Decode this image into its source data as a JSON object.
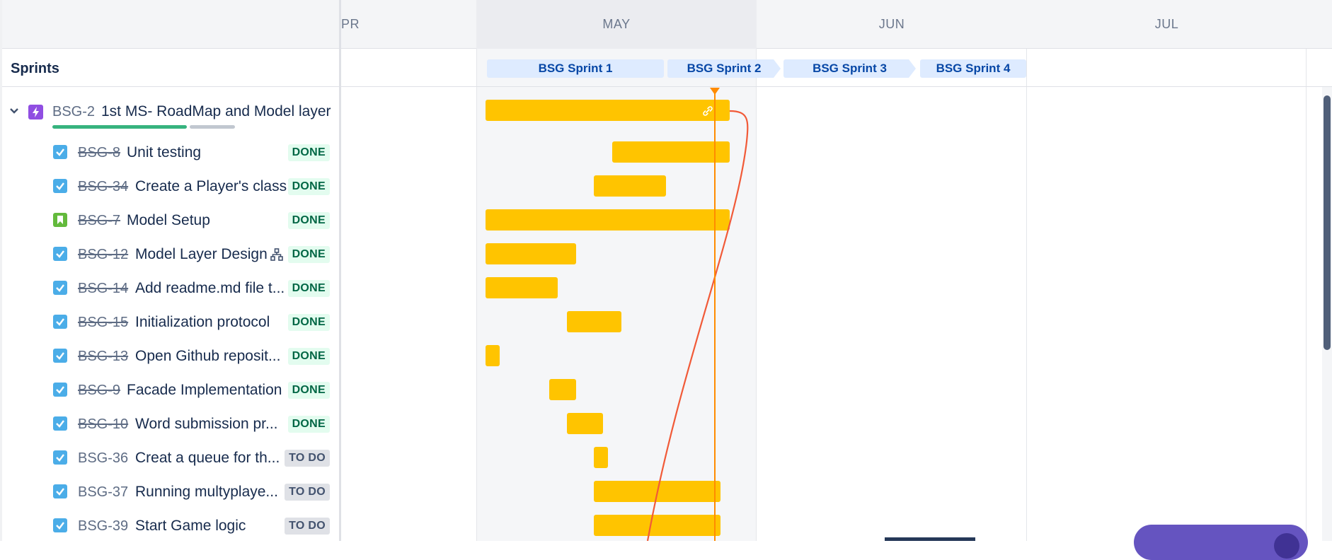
{
  "header": {
    "months": [
      "PR",
      "MAY",
      "JUN",
      "JUL"
    ]
  },
  "sprints": {
    "title": "Sprints",
    "items": [
      {
        "label": "BSG Sprint 1"
      },
      {
        "label": "BSG Sprint 2"
      },
      {
        "label": "BSG Sprint 3"
      },
      {
        "label": "BSG Sprint 4"
      }
    ]
  },
  "epic": {
    "key": "BSG-2",
    "title": "1st MS- RoadMap and Model layer",
    "progress_done": 0.74,
    "progress_inprogress": 0.0,
    "icon": "lightning-icon",
    "color": "#904ee2"
  },
  "issues": [
    {
      "key": "BSG-8",
      "title": "Unit testing",
      "status": "DONE",
      "done": true,
      "type": "task"
    },
    {
      "key": "BSG-34",
      "title": "Create a Player's class",
      "status": "DONE",
      "done": true,
      "type": "task"
    },
    {
      "key": "BSG-7",
      "title": "Model Setup",
      "status": "DONE",
      "done": true,
      "type": "story"
    },
    {
      "key": "BSG-12",
      "title": "Model Layer Design",
      "status": "DONE",
      "done": true,
      "type": "task",
      "has_children_icon": "hierarchy-icon"
    },
    {
      "key": "BSG-14",
      "title": "Add readme.md file t...",
      "status": "DONE",
      "done": true,
      "type": "task"
    },
    {
      "key": "BSG-15",
      "title": "Initialization protocol",
      "status": "DONE",
      "done": true,
      "type": "task"
    },
    {
      "key": "BSG-13",
      "title": "Open Github reposit...",
      "status": "DONE",
      "done": true,
      "type": "task"
    },
    {
      "key": "BSG-9",
      "title": "Facade Implementation",
      "status": "DONE",
      "done": true,
      "type": "task"
    },
    {
      "key": "BSG-10",
      "title": "Word submission pr...",
      "status": "DONE",
      "done": true,
      "type": "task"
    },
    {
      "key": "BSG-36",
      "title": "Creat a queue for th...",
      "status": "TO DO",
      "done": false,
      "type": "task"
    },
    {
      "key": "BSG-37",
      "title": "Running multyplaye...",
      "status": "TO DO",
      "done": false,
      "type": "task"
    },
    {
      "key": "BSG-39",
      "title": "Start Game logic",
      "status": "TO DO",
      "done": false,
      "type": "task"
    }
  ],
  "colors": {
    "bar": "#ffc400",
    "today": "#ff8b00",
    "dependency": "#f15a38",
    "sprint_chip": "#deebff"
  }
}
